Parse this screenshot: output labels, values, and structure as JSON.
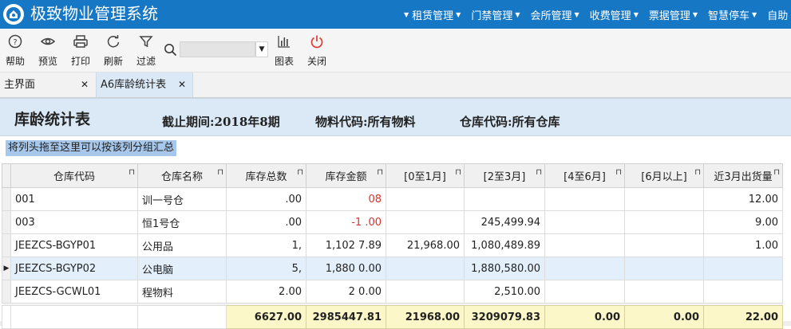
{
  "app": {
    "title": "极致物业管理系统"
  },
  "topnav": [
    "租赁管理",
    "门禁管理",
    "会所管理",
    "收费管理",
    "票据管理",
    "智慧停车",
    "自助"
  ],
  "toolbar": {
    "help": "帮助",
    "preview": "预览",
    "print": "打印",
    "refresh": "刷新",
    "filter": "过滤",
    "chart": "图表",
    "close": "关闭",
    "search_value": ""
  },
  "tabs": [
    {
      "label": "主界面"
    },
    {
      "label": "A6库龄统计表"
    }
  ],
  "report": {
    "title": "库龄统计表",
    "period": "截止期间:2018年8期",
    "material": "物料代码:所有物料",
    "warehouse": "仓库代码:所有仓库",
    "group_hint": "将列头拖至这里可以按该列分组汇总"
  },
  "grid": {
    "columns": [
      "仓库代码",
      "仓库名称",
      "库存总数",
      "库存金额",
      "[0至1月]",
      "[2至3月]",
      "[4至6月]",
      "[6月以上]",
      "近3月出货量"
    ],
    "rows": [
      [
        "001",
        "训一号仓",
        ".00",
        "08",
        "",
        "",
        "",
        "",
        "12.00"
      ],
      [
        "003",
        "恒1号仓",
        ".00",
        "-1  .00",
        "",
        "245,499.94",
        "",
        "",
        "9.00"
      ],
      [
        "JEEZCS-BGYP01",
        "公用品",
        "1,",
        "1,102    7.89",
        "21,968.00",
        "1,080,489.89",
        "",
        "",
        "1.00"
      ],
      [
        "JEEZCS-BGYP02",
        "公电脑",
        "5,",
        "1,880    0.00",
        "",
        "1,880,580.00",
        "",
        "",
        ""
      ],
      [
        "JEEZCS-GCWL01",
        "程物料",
        "2.00",
        "2    0.00",
        "",
        "2,510.00",
        "",
        "",
        ""
      ]
    ],
    "totals": [
      "6627.00",
      "2985447.81",
      "21968.00",
      "3209079.83",
      "0.00",
      "0.00",
      "22.00"
    ]
  },
  "colors": {
    "header": "#1677c5",
    "report_band": "#dbe9f6",
    "group_hint": "#a7c8ea",
    "total_row": "#fbf7c8",
    "negative": "#e0302a"
  }
}
